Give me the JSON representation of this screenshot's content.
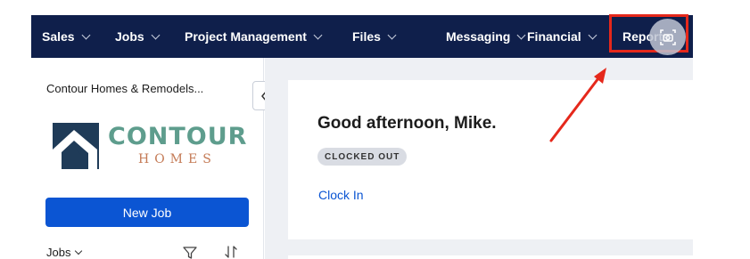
{
  "nav": {
    "items": [
      {
        "label": "Sales"
      },
      {
        "label": "Jobs"
      },
      {
        "label": "Project Management"
      },
      {
        "label": "Files"
      },
      {
        "label": "Messaging"
      },
      {
        "label": "Financial"
      },
      {
        "label": "Reports"
      }
    ]
  },
  "sidebar": {
    "company_name": "Contour Homes & Remodels...",
    "logo_word": "CONTOUR",
    "logo_sub": "HOMES",
    "new_job_label": "New Job",
    "jobs_filter_label": "Jobs"
  },
  "main": {
    "greeting": "Good afternoon, Mike.",
    "status_badge": "CLOCKED OUT",
    "clock_in_label": "Clock In"
  },
  "colors": {
    "nav_bg": "#0f1f4b",
    "primary": "#0b55d3",
    "highlight": "#e5281b",
    "logo_green": "#5e9d8d",
    "logo_navy": "#1f3b58"
  }
}
